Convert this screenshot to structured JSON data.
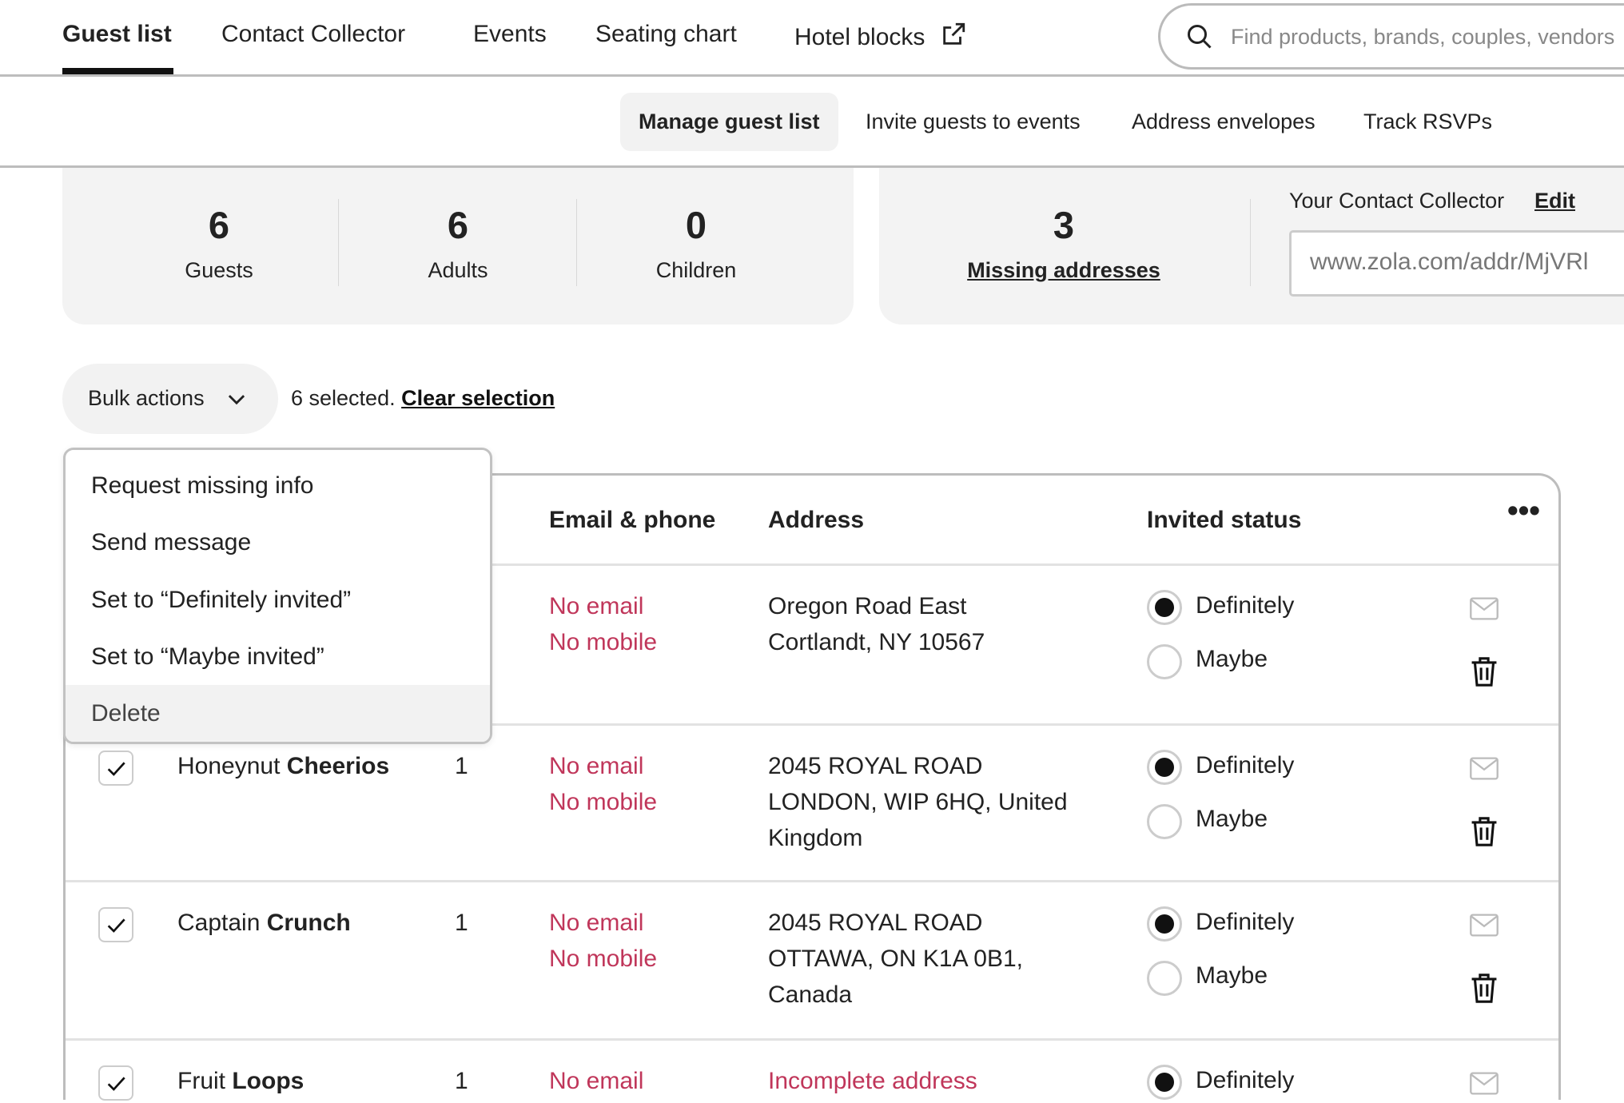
{
  "top_nav": {
    "tabs": [
      {
        "label": "Guest list",
        "active": true
      },
      {
        "label": "Contact Collector"
      },
      {
        "label": "Events"
      },
      {
        "label": "Seating chart"
      },
      {
        "label": "Hotel blocks",
        "icon": "external-link-icon"
      }
    ],
    "search_placeholder": "Find products, brands, couples, vendors"
  },
  "sub_nav": {
    "tabs": [
      {
        "label": "Manage guest list",
        "active": true
      },
      {
        "label": "Invite guests to events"
      },
      {
        "label": "Address envelopes"
      },
      {
        "label": "Track RSVPs"
      }
    ]
  },
  "stats": {
    "guests": {
      "value": "6",
      "label": "Guests"
    },
    "adults": {
      "value": "6",
      "label": "Adults"
    },
    "children": {
      "value": "0",
      "label": "Children"
    },
    "missing": {
      "value": "3",
      "label": "Missing addresses"
    }
  },
  "contact_collector": {
    "label": "Your Contact Collector",
    "edit": "Edit",
    "url": "www.zola.com/addr/MjVRl"
  },
  "bulk": {
    "label": "Bulk actions",
    "selected_text": "6 selected.",
    "clear": "Clear selection"
  },
  "menu": [
    "Request missing info",
    "Send message",
    "Set to “Definitely invited”",
    "Set to “Maybe invited”",
    "Delete"
  ],
  "table": {
    "headers": {
      "email": "Email & phone",
      "address": "Address",
      "status": "Invited status"
    },
    "definitely": "Definitely",
    "maybe": "Maybe",
    "rows": [
      {
        "first": "",
        "last": "",
        "count": "",
        "email": "No email",
        "mobile": "No mobile",
        "address": [
          "Oregon Road East",
          "Cortlandt, NY 10567"
        ],
        "status": "definitely"
      },
      {
        "first": "Honeynut",
        "last": "Cheerios",
        "count": "1",
        "email": "No email",
        "mobile": "No mobile",
        "address": [
          "2045 ROYAL ROAD",
          "LONDON, WIP 6HQ, United",
          "Kingdom"
        ],
        "status": "definitely"
      },
      {
        "first": "Captain",
        "last": "Crunch",
        "count": "1",
        "email": "No email",
        "mobile": "No mobile",
        "address": [
          "2045 ROYAL ROAD",
          "OTTAWA, ON K1A 0B1,",
          "Canada"
        ],
        "status": "definitely"
      },
      {
        "first": "Fruit",
        "last": "Loops",
        "count": "1",
        "email": "No email",
        "mobile": "",
        "address": [
          "Incomplete address"
        ],
        "address_warning": true,
        "status": "definitely"
      }
    ]
  },
  "colors": {
    "warning": "#c0365a",
    "card": "#f3f3f3"
  }
}
